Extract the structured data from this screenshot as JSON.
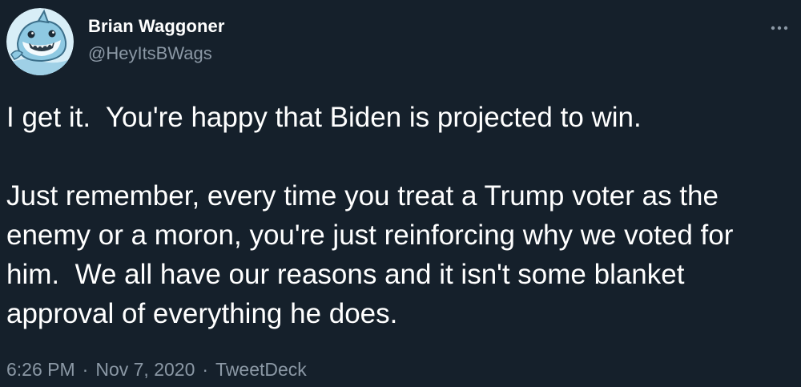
{
  "tweet": {
    "author": {
      "display_name": "Brian Waggoner",
      "handle": "@HeyItsBWags",
      "avatar_icon": "shark-cartoon-avatar"
    },
    "more_icon": "more-horizontal-icon",
    "paragraphs": [
      "I get it.  You're happy that Biden is projected to win.",
      "Just remember, every time you treat a Trump voter as the enemy or a moron, you're just reinforcing why we voted for him.  We all have our reasons and it isn't some blanket approval of everything he does."
    ],
    "meta": {
      "time": "6:26 PM",
      "date": "Nov 7, 2020",
      "source": "TweetDeck",
      "separator": "·"
    }
  },
  "colors": {
    "background": "#15202b",
    "text_primary": "#ffffff",
    "text_secondary": "#8b98a5"
  }
}
